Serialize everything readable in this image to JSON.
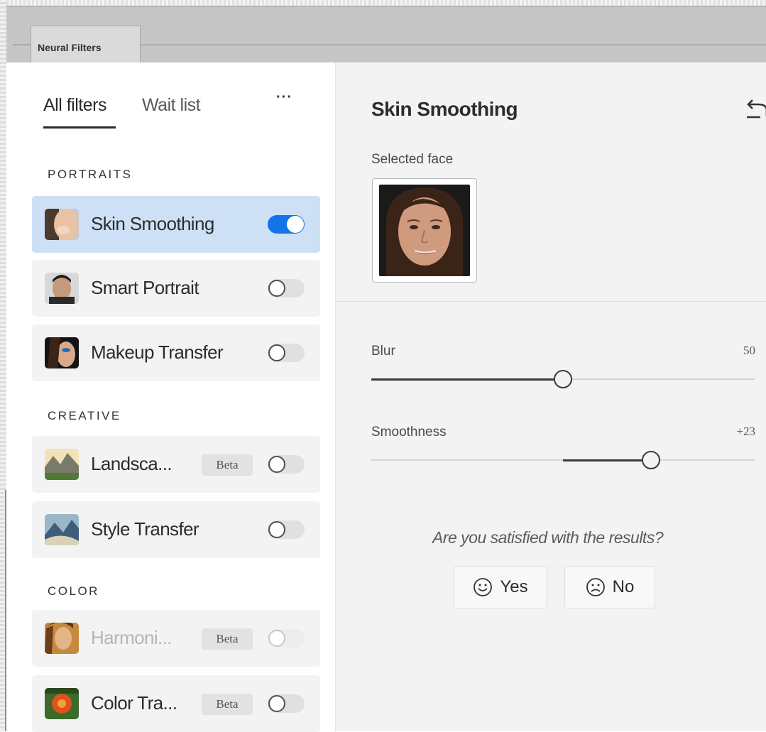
{
  "window": {
    "tab_label": "Neural Filters"
  },
  "filters_panel": {
    "tabs": [
      {
        "label": "All filters",
        "active": true
      },
      {
        "label": "Wait list",
        "active": false
      }
    ],
    "more_menu_label": "···",
    "sections": [
      {
        "title": "PORTRAITS",
        "items": [
          {
            "label": "Skin Smoothing",
            "icon": "skin-smoothing-thumbnail",
            "enabled": true,
            "selected": true
          },
          {
            "label": "Smart Portrait",
            "icon": "smart-portrait-thumbnail",
            "enabled": false
          },
          {
            "label": "Makeup Transfer",
            "icon": "makeup-transfer-thumbnail",
            "enabled": false
          }
        ]
      },
      {
        "title": "CREATIVE",
        "items": [
          {
            "label": "Landsca...",
            "icon": "landscape-mixer-thumbnail",
            "badge": "Beta",
            "enabled": false
          },
          {
            "label": "Style Transfer",
            "icon": "style-transfer-thumbnail",
            "enabled": false
          }
        ]
      },
      {
        "title": "COLOR",
        "items": [
          {
            "label": "Harmoni...",
            "icon": "harmonization-thumbnail",
            "badge": "Beta",
            "enabled": false,
            "disabled": true
          },
          {
            "label": "Color Tra...",
            "icon": "color-transfer-thumbnail",
            "badge": "Beta",
            "enabled": false
          }
        ]
      }
    ]
  },
  "detail_panel": {
    "title": "Skin Smoothing",
    "reset_icon": "reset-icon",
    "selected_face_label": "Selected face",
    "sliders": [
      {
        "label": "Blur",
        "value_text": "50",
        "value": 50,
        "min": 0,
        "max": 100
      },
      {
        "label": "Smoothness",
        "value_text": "+23",
        "value": 23,
        "min": -50,
        "max": 50
      }
    ],
    "feedback": {
      "question": "Are you satisfied with the results?",
      "yes_label": "Yes",
      "no_label": "No"
    }
  },
  "colors": {
    "accent": "#1473e6",
    "selected_row": "#cde0f5",
    "panel_background": "#f3f3f3",
    "tab_bar": "#c6c6c6"
  }
}
